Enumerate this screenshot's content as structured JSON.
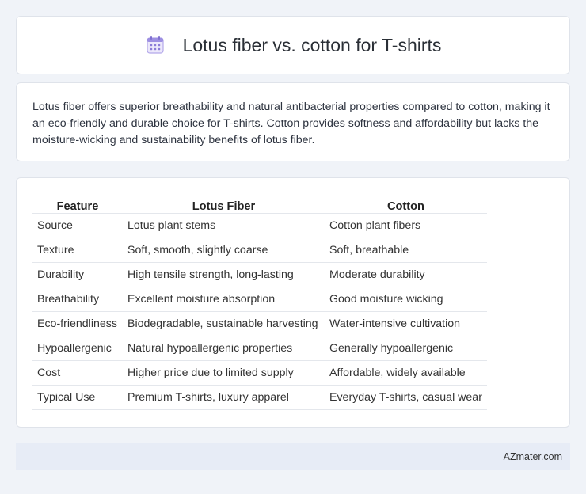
{
  "header": {
    "title": "Lotus fiber vs. cotton for T-shirts",
    "icon": "calendar-icon",
    "icon_color": "#8a7bd8"
  },
  "summary": {
    "text": "Lotus fiber offers superior breathability and natural antibacterial properties compared to cotton, making it an eco-friendly and durable choice for T-shirts. Cotton provides softness and affordability but lacks the moisture-wicking and sustainability benefits of lotus fiber."
  },
  "table": {
    "headers": [
      "Feature",
      "Lotus Fiber",
      "Cotton"
    ],
    "rows": [
      [
        "Source",
        "Lotus plant stems",
        "Cotton plant fibers"
      ],
      [
        "Texture",
        "Soft, smooth, slightly coarse",
        "Soft, breathable"
      ],
      [
        "Durability",
        "High tensile strength, long-lasting",
        "Moderate durability"
      ],
      [
        "Breathability",
        "Excellent moisture absorption",
        "Good moisture wicking"
      ],
      [
        "Eco-friendliness",
        "Biodegradable, sustainable harvesting",
        "Water-intensive cultivation"
      ],
      [
        "Hypoallergenic",
        "Natural hypoallergenic properties",
        "Generally hypoallergenic"
      ],
      [
        "Cost",
        "Higher price due to limited supply",
        "Affordable, widely available"
      ],
      [
        "Typical Use",
        "Premium T-shirts, luxury apparel",
        "Everyday T-shirts, casual wear"
      ]
    ]
  },
  "footer": {
    "text": "AZmater.com"
  }
}
